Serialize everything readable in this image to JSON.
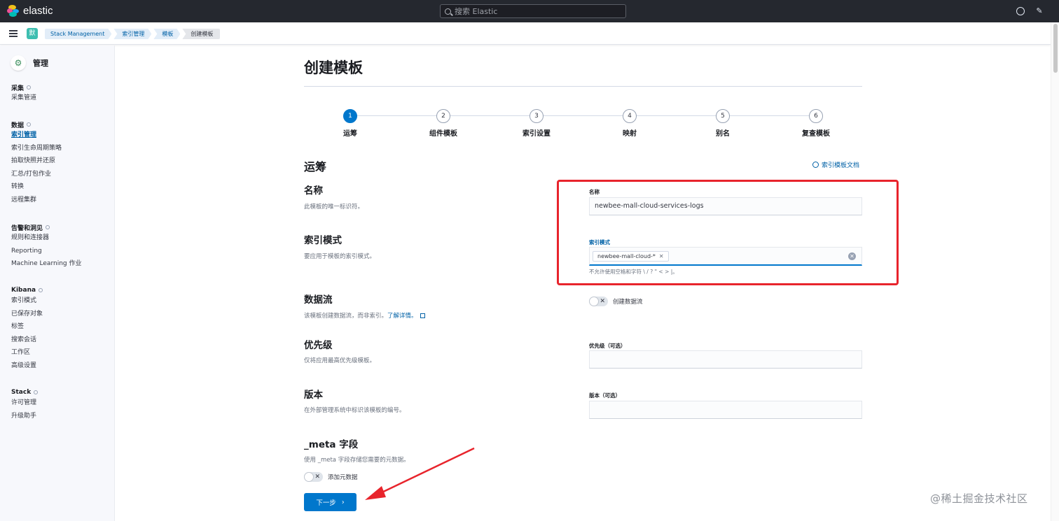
{
  "app": {
    "brand": "elastic",
    "search_placeholder": "搜索 Elastic"
  },
  "space": {
    "initial": "默"
  },
  "breadcrumbs": [
    "Stack Management",
    "索引管理",
    "模板",
    "创建模板"
  ],
  "sidebar": {
    "title": "管理",
    "groups": [
      {
        "title": "采集",
        "items": [
          "采集管道"
        ]
      },
      {
        "title": "数据",
        "items": [
          "索引管理",
          "索引生命周期策略",
          "拍取快照并还原",
          "汇总/打包作业",
          "转换",
          "远程集群"
        ]
      },
      {
        "title": "告警和洞见",
        "items": [
          "规则和连接器",
          "Reporting",
          "Machine Learning 作业"
        ]
      },
      {
        "title": "Kibana",
        "items": [
          "索引模式",
          "已保存对象",
          "标签",
          "搜索会话",
          "工作区",
          "高级设置"
        ]
      },
      {
        "title": "Stack",
        "items": [
          "许可管理",
          "升级助手"
        ]
      }
    ],
    "active_item": "索引管理"
  },
  "page": {
    "title": "创建模板",
    "steps": [
      {
        "num": "1",
        "label": "运筹"
      },
      {
        "num": "2",
        "label": "组件模板"
      },
      {
        "num": "3",
        "label": "索引设置"
      },
      {
        "num": "4",
        "label": "映射"
      },
      {
        "num": "5",
        "label": "别名"
      },
      {
        "num": "6",
        "label": "复查模板"
      }
    ],
    "current_step": 1,
    "section_title": "运筹",
    "docs_link": "索引模板文档",
    "fields": {
      "name": {
        "title": "名称",
        "desc": "此模板的唯一标识符。",
        "label": "名称",
        "value": "newbee-mall-cloud-services-logs"
      },
      "index_patterns": {
        "title": "索引模式",
        "desc": "要应用于模板的索引模式。",
        "label": "索引模式",
        "pill": "newbee-mall-cloud-*",
        "help": "不允许使用空格和字符 \\ / ? \" < > |。"
      },
      "data_stream": {
        "title": "数据流",
        "desc": "该模板创建数据流，而非索引。",
        "learn_more": "了解详情。",
        "toggle_label": "创建数据流"
      },
      "priority": {
        "title": "优先级",
        "desc": "仅将应用最高优先级模板。",
        "label": "优先级（可选）",
        "value": ""
      },
      "version": {
        "title": "版本",
        "desc": "在外部管理系统中标识该模板的编号。",
        "label": "版本（可选）",
        "value": ""
      },
      "meta": {
        "title": "_meta 字段",
        "desc": "使用 _meta 字段存储您需要的元数据。",
        "toggle_label": "添加元数据"
      }
    },
    "next_button": "下一步"
  },
  "watermark": "@稀土掘金技术社区",
  "colors": {
    "primary": "#0077cc",
    "annotation": "#e8242c",
    "topbar": "#25282f"
  }
}
